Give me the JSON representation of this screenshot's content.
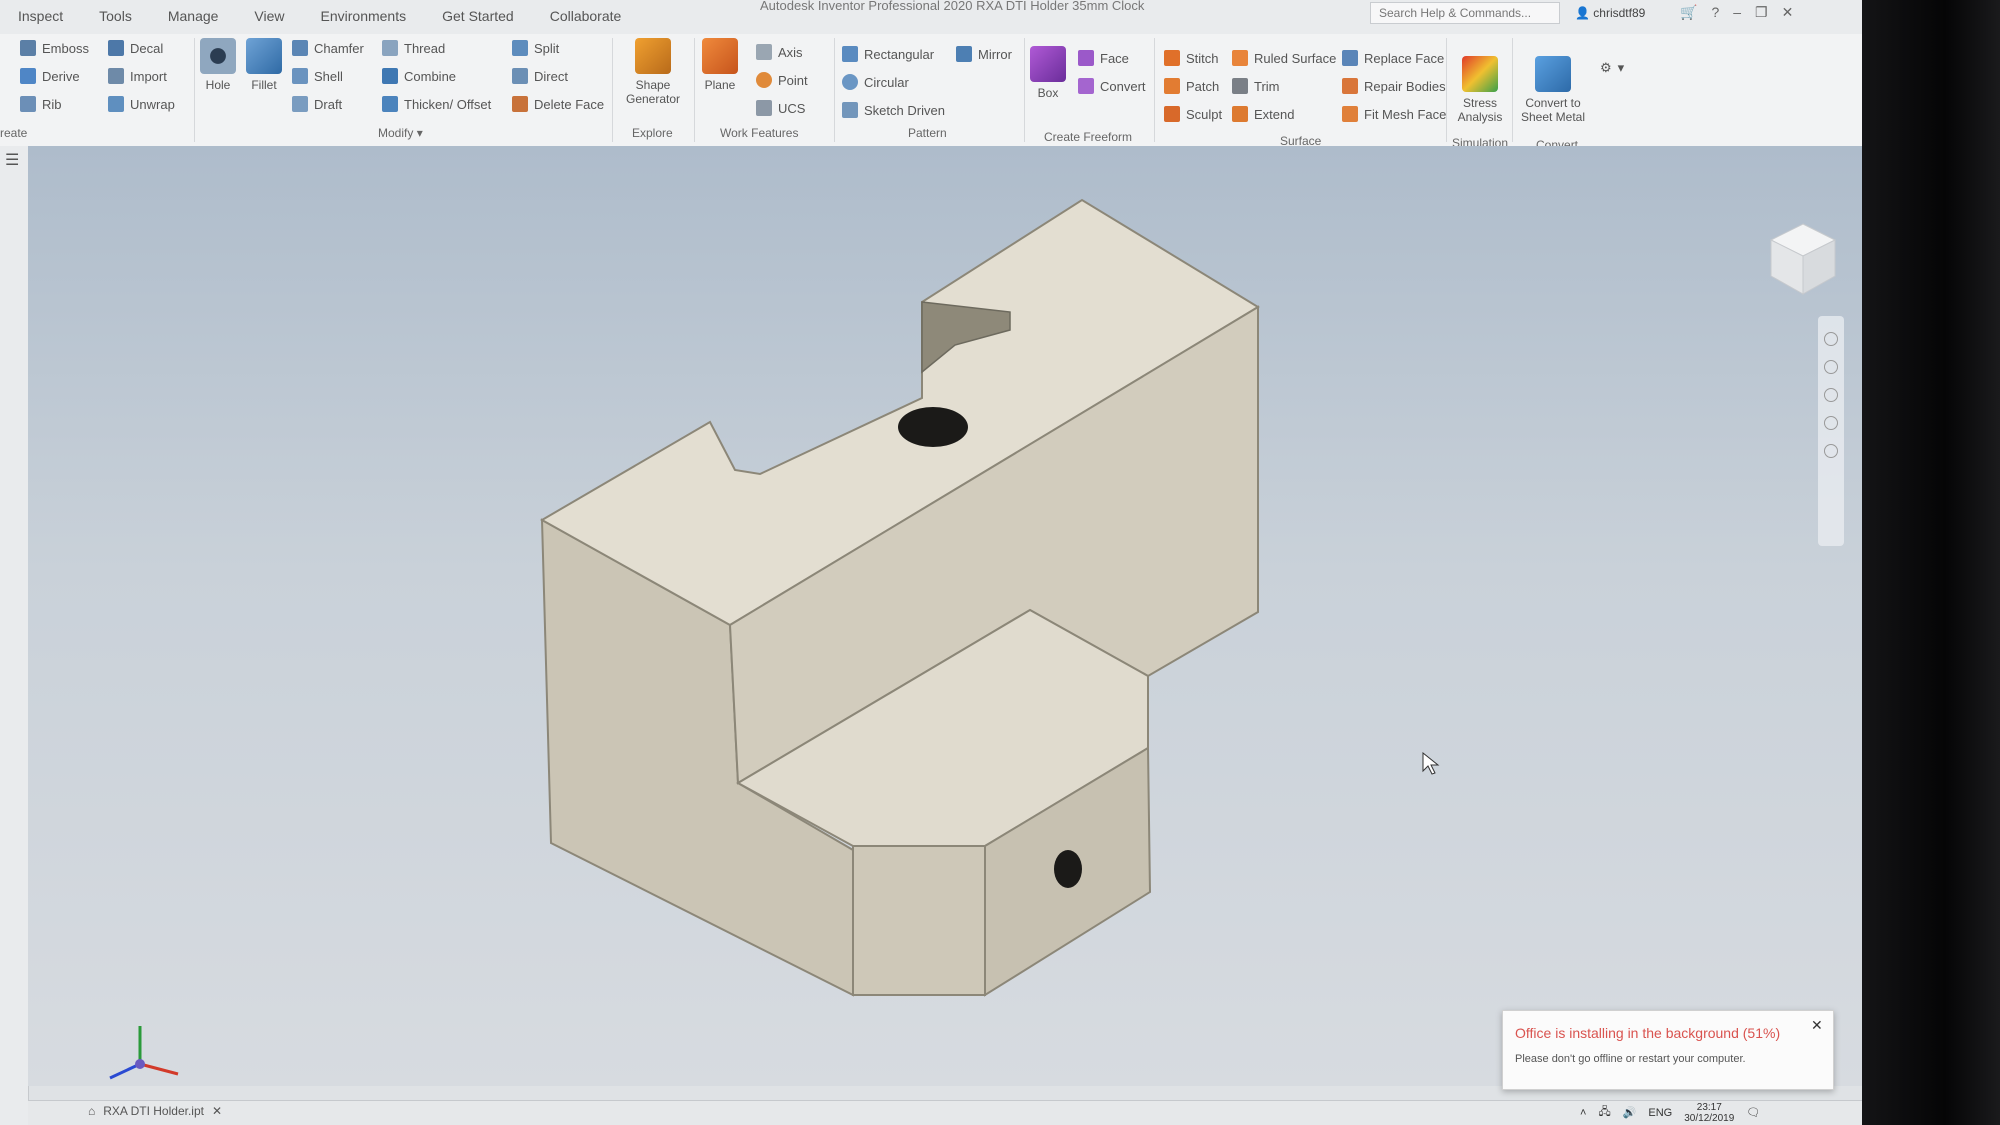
{
  "menu": [
    "Inspect",
    "Tools",
    "Manage",
    "View",
    "Environments",
    "Get Started",
    "Collaborate"
  ],
  "app_title": "Autodesk Inventor Professional 2020   RXA DTI Holder 35mm Clock",
  "search_placeholder": "Search Help & Commands...",
  "user_name": "chrisdtf89",
  "ribbon": {
    "create": {
      "emboss": "Emboss",
      "derive": "Derive",
      "rib": "Rib",
      "decal": "Decal",
      "import": "Import",
      "unwrap": "Unwrap",
      "label": "reate"
    },
    "modify": {
      "hole": "Hole",
      "fillet": "Fillet",
      "chamfer": "Chamfer",
      "shell": "Shell",
      "draft": "Draft",
      "thread": "Thread",
      "combine": "Combine",
      "thicken": "Thicken/ Offset",
      "split": "Split",
      "direct": "Direct",
      "delete_face": "Delete Face",
      "label": "Modify"
    },
    "explore": {
      "shape_generator": "Shape Generator",
      "label": "Explore"
    },
    "work_features": {
      "plane": "Plane",
      "axis": "Axis",
      "point": "Point",
      "ucs": "UCS",
      "label": "Work Features"
    },
    "pattern": {
      "rectangular": "Rectangular",
      "circular": "Circular",
      "sketch_driven": "Sketch Driven",
      "mirror": "Mirror",
      "label": "Pattern"
    },
    "freeform": {
      "box": "Box",
      "face": "Face",
      "convert": "Convert",
      "label": "Create Freeform"
    },
    "surface": {
      "stitch": "Stitch",
      "patch": "Patch",
      "sculpt": "Sculpt",
      "ruled_surface": "Ruled Surface",
      "trim": "Trim",
      "extend": "Extend",
      "replace_face": "Replace Face",
      "repair_bodies": "Repair Bodies",
      "fit_mesh_face": "Fit Mesh Face",
      "label": "Surface"
    },
    "simulation": {
      "stress": "Stress Analysis",
      "label": "Simulation"
    },
    "convert": {
      "sheet_metal": "Convert to Sheet Metal",
      "label": "Convert"
    }
  },
  "colors": {
    "model_top": "#e2ddd0",
    "model_front": "#cdc7b7",
    "model_side": "#bcb6a6",
    "accent_red": "#d9534f"
  },
  "toast": {
    "title": "Office is installing in the background (51%)",
    "body": "Please don't go offline or restart your computer.",
    "progress_percent": 51
  },
  "document_tab": "RXA DTI Holder.ipt",
  "taskbar": {
    "lang": "ENG",
    "time": "23:17",
    "date": "30/12/2019"
  }
}
